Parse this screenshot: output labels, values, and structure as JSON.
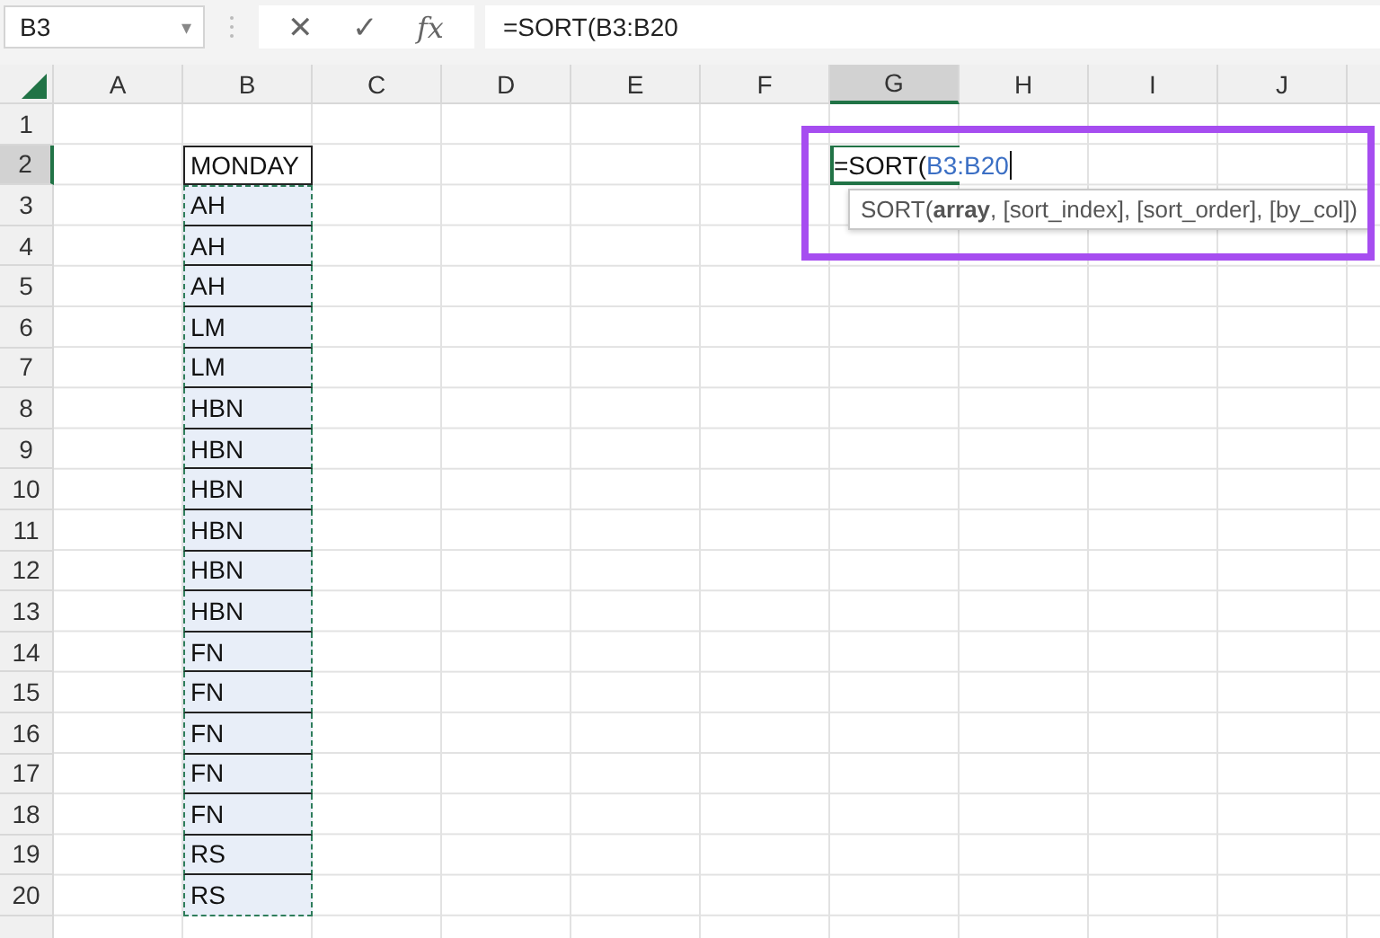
{
  "name_box": {
    "value": "B3",
    "dropdown": "▾"
  },
  "formula_bar": {
    "cancel": "✕",
    "enter": "✓",
    "fx": "fx",
    "value": "=SORT(B3:B20"
  },
  "columns": [
    {
      "label": "A",
      "selected": false
    },
    {
      "label": "B",
      "selected": false
    },
    {
      "label": "C",
      "selected": false
    },
    {
      "label": "D",
      "selected": false
    },
    {
      "label": "E",
      "selected": false
    },
    {
      "label": "F",
      "selected": false
    },
    {
      "label": "G",
      "selected": true
    },
    {
      "label": "H",
      "selected": false
    },
    {
      "label": "I",
      "selected": false
    },
    {
      "label": "J",
      "selected": false
    }
  ],
  "rows": [
    {
      "number": "1",
      "selected": false
    },
    {
      "number": "2",
      "selected": true,
      "in_range": false,
      "b": "MONDAY",
      "editing": {
        "prefix": "=SORT(",
        "reference": "B3:B20"
      }
    },
    {
      "number": "3",
      "selected": false,
      "in_range": true,
      "b": "AH"
    },
    {
      "number": "4",
      "selected": false,
      "in_range": true,
      "b": "AH"
    },
    {
      "number": "5",
      "selected": false,
      "in_range": true,
      "b": "AH"
    },
    {
      "number": "6",
      "selected": false,
      "in_range": true,
      "b": "LM"
    },
    {
      "number": "7",
      "selected": false,
      "in_range": true,
      "b": "LM"
    },
    {
      "number": "8",
      "selected": false,
      "in_range": true,
      "b": "HBN"
    },
    {
      "number": "9",
      "selected": false,
      "in_range": true,
      "b": "HBN"
    },
    {
      "number": "10",
      "selected": false,
      "in_range": true,
      "b": "HBN"
    },
    {
      "number": "11",
      "selected": false,
      "in_range": true,
      "b": "HBN"
    },
    {
      "number": "12",
      "selected": false,
      "in_range": true,
      "b": "HBN"
    },
    {
      "number": "13",
      "selected": false,
      "in_range": true,
      "b": "HBN"
    },
    {
      "number": "14",
      "selected": false,
      "in_range": true,
      "b": "FN"
    },
    {
      "number": "15",
      "selected": false,
      "in_range": true,
      "b": "FN"
    },
    {
      "number": "16",
      "selected": false,
      "in_range": true,
      "b": "FN"
    },
    {
      "number": "17",
      "selected": false,
      "in_range": true,
      "b": "FN"
    },
    {
      "number": "18",
      "selected": false,
      "in_range": true,
      "b": "FN"
    },
    {
      "number": "19",
      "selected": false,
      "in_range": true,
      "b": "RS"
    },
    {
      "number": "20",
      "selected": false,
      "in_range": true,
      "b": "RS"
    }
  ],
  "tooltip": {
    "text": "SORT(**array**, [sort_index], [sort_order], [by_col])"
  },
  "highlight": {
    "color": "#a64df0"
  }
}
